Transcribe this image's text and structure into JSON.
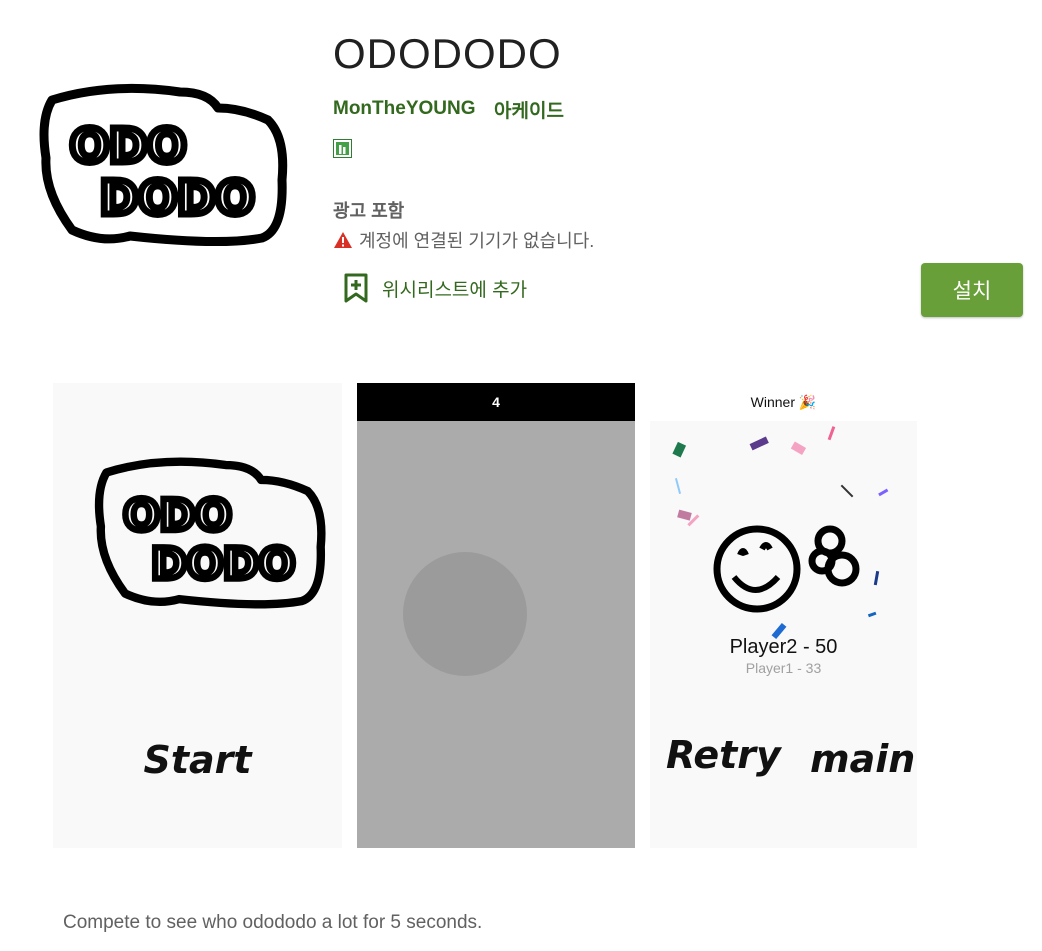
{
  "app": {
    "title": "ODODODO",
    "developer": "MonTheYOUNG",
    "genre": "아케이드",
    "rating_icon": "content-rating-icon",
    "ads_notice": "광고 포함",
    "warning": "계정에 연결된 기기가 없습니다.",
    "wishlist_label": "위시리스트에 추가",
    "install_label": "설치",
    "logo_text": [
      "ODO",
      "DODO"
    ],
    "description": "Compete to see who odododo a lot for 5 seconds."
  },
  "screenshots": {
    "shot1": {
      "start_label": "Start"
    },
    "shot2": {
      "counter": "4"
    },
    "shot3": {
      "winner_label": "Winner 🎉",
      "player2_score": "Player2 - 50",
      "player1_score": "Player1 - 33",
      "retry_label": "Retry",
      "main_label": "main"
    }
  },
  "colors": {
    "accent_green": "#33691e",
    "install_button": "#689f38",
    "warning_red": "#d93025",
    "text_gray": "#616161"
  }
}
